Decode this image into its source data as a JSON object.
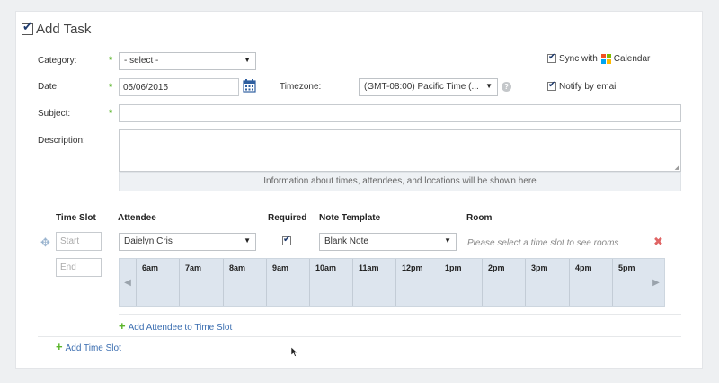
{
  "title": "Add Task",
  "form": {
    "category_label": "Category:",
    "category_value": "- select -",
    "date_label": "Date:",
    "date_value": "05/06/2015",
    "timezone_label": "Timezone:",
    "timezone_value": "(GMT-08:00) Pacific Time (...",
    "subject_label": "Subject:",
    "description_label": "Description:",
    "info_text": "Information about times, attendees, and locations will be shown here",
    "sync_prefix": "Sync with",
    "sync_suffix": "Calendar",
    "notify_label": "Notify by email"
  },
  "slots": {
    "headers": {
      "time_slot": "Time Slot",
      "attendee": "Attendee",
      "required": "Required",
      "note_template": "Note Template",
      "room": "Room"
    },
    "start_placeholder": "Start",
    "end_placeholder": "End",
    "attendee_value": "Daielyn Cris",
    "note_value": "Blank Note",
    "room_hint": "Please select a time slot to see rooms",
    "hours": [
      "6am",
      "7am",
      "8am",
      "9am",
      "10am",
      "11am",
      "12pm",
      "1pm",
      "2pm",
      "3pm",
      "4pm",
      "5pm"
    ],
    "add_attendee": "Add Attendee to Time Slot",
    "add_time_slot": "Add Time Slot"
  },
  "icons": {
    "required_marker": "*",
    "help": "?",
    "remove": "✖",
    "left": "◀",
    "right": "▶",
    "plus": "+",
    "move": "✥"
  },
  "colors": {
    "required": "#5bb52b",
    "link": "#3a6db0",
    "remove": "#e06565"
  }
}
